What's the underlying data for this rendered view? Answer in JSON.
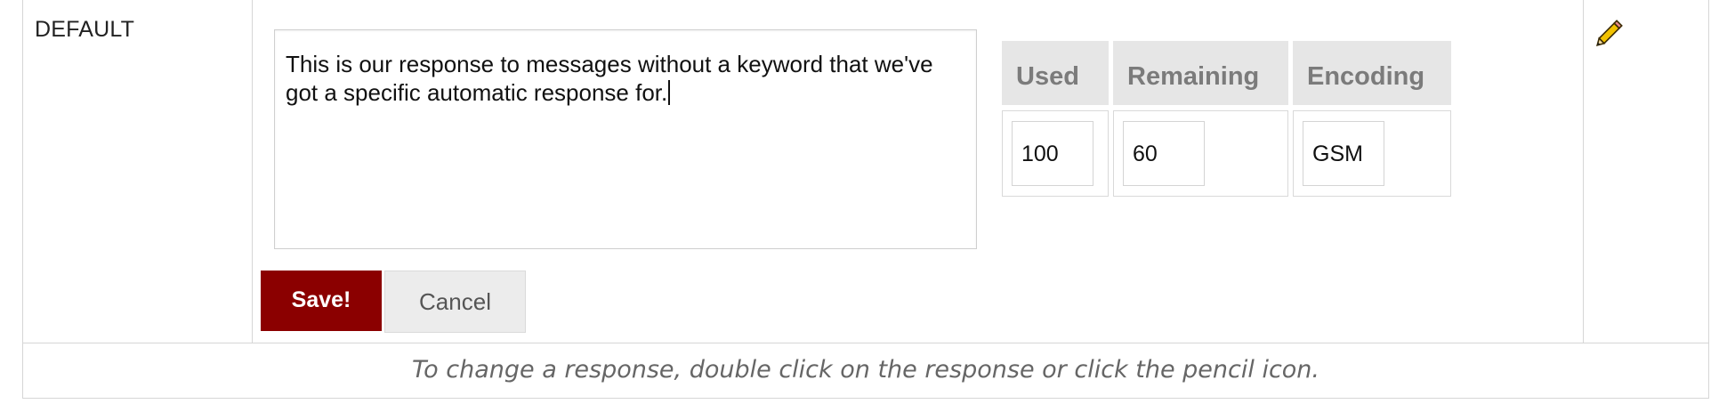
{
  "row": {
    "keyword": "DEFAULT",
    "response_text": "This is our response to messages without a keyword that we've got a specific automatic response for."
  },
  "stats": {
    "headers": {
      "used": "Used",
      "remaining": "Remaining",
      "encoding": "Encoding"
    },
    "values": {
      "used": "100",
      "remaining": "60",
      "encoding": "GSM"
    }
  },
  "buttons": {
    "save": "Save!",
    "cancel": "Cancel"
  },
  "edit_icon": "pencil-icon",
  "hint": "To change a response, double click on the response or click the pencil icon.",
  "colors": {
    "save_button": "#8b0000",
    "header_bg": "#e6e6e6",
    "border": "#d6d6d6"
  }
}
